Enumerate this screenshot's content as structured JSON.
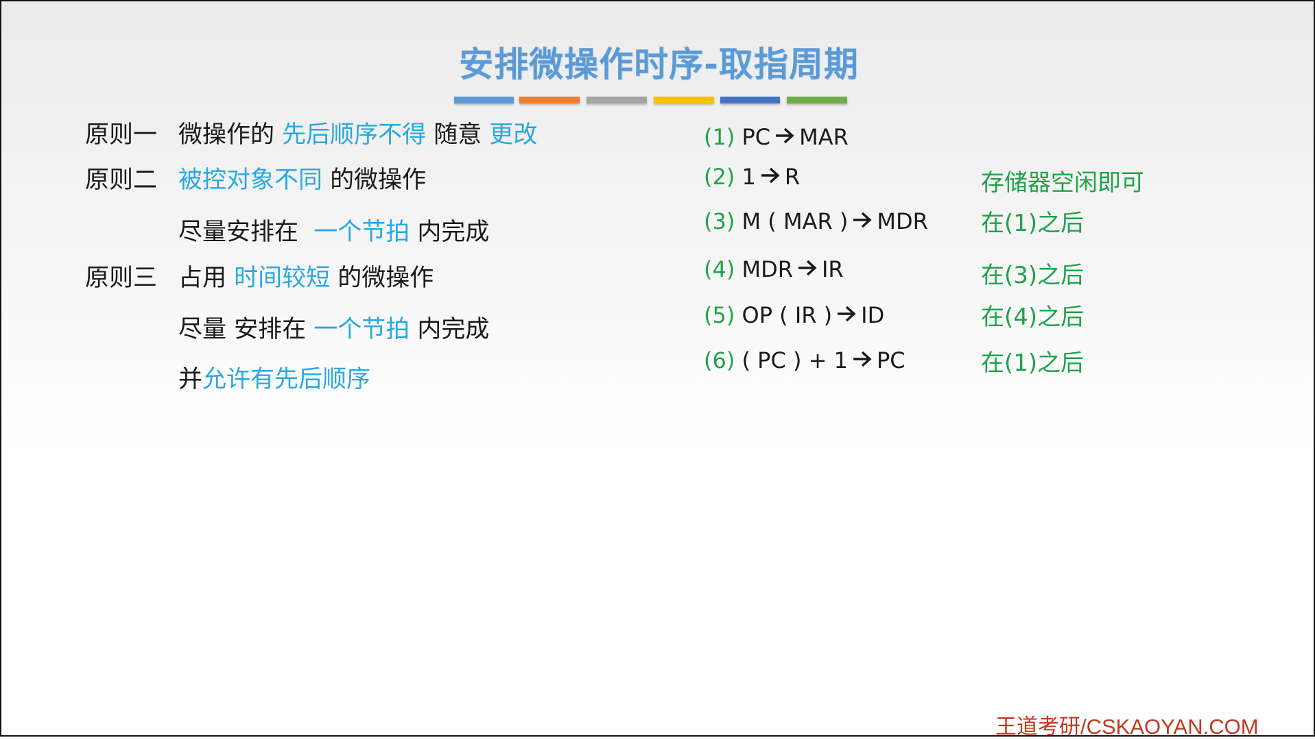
{
  "title": "安排微操作时序-取指周期",
  "accent_colors": [
    "#5b9bd5",
    "#ed7d31",
    "#a5a5a5",
    "#ffc000",
    "#4472c4",
    "#70ad47"
  ],
  "principles": {
    "p1": {
      "label": "原则一",
      "a": "微操作的 ",
      "b": "先后顺序不得",
      "c": " 随意 ",
      "d": "更改"
    },
    "p2": {
      "label": "原则二",
      "a": "被控对象不同",
      "b": " 的微操作"
    },
    "p2_line2": {
      "a": "尽量安排在  ",
      "b": "一个节拍",
      "c": " 内完成"
    },
    "p3": {
      "label": "原则三",
      "a": "占用 ",
      "b": "时间较短",
      "c": " 的微操作"
    },
    "p3_line2": {
      "a": "尽量 安排在 ",
      "b": "一个节拍",
      "c": " 内完成"
    },
    "p3_line3": {
      "a": "并",
      "b": "允许有先后顺序"
    }
  },
  "steps": [
    {
      "num": "(1)",
      "left": "PC",
      "right": "MAR",
      "arrow_icon": "right-arrow"
    },
    {
      "num": "(2)",
      "left": "1",
      "right": "R",
      "arrow_icon": "right-arrow"
    },
    {
      "num": "(3)",
      "left": "M ( MAR )",
      "right": "MDR",
      "arrow_icon": "right-arrow"
    },
    {
      "num": "(4)",
      "left": "MDR",
      "right": "IR",
      "arrow_icon": "right-arrow"
    },
    {
      "num": "(5)",
      "left": "OP ( IR )",
      "right": "ID",
      "arrow_icon": "right-arrow"
    },
    {
      "num": "(6)",
      "left": "( PC ) + 1",
      "right": "PC",
      "arrow_icon": "right-arrow"
    }
  ],
  "notes": [
    "存储器空闲即可",
    "在(1)之后",
    "在(3)之后",
    "在(4)之后",
    "在(1)之后"
  ],
  "footer": "王道考研/CSKAOYAN.COM"
}
